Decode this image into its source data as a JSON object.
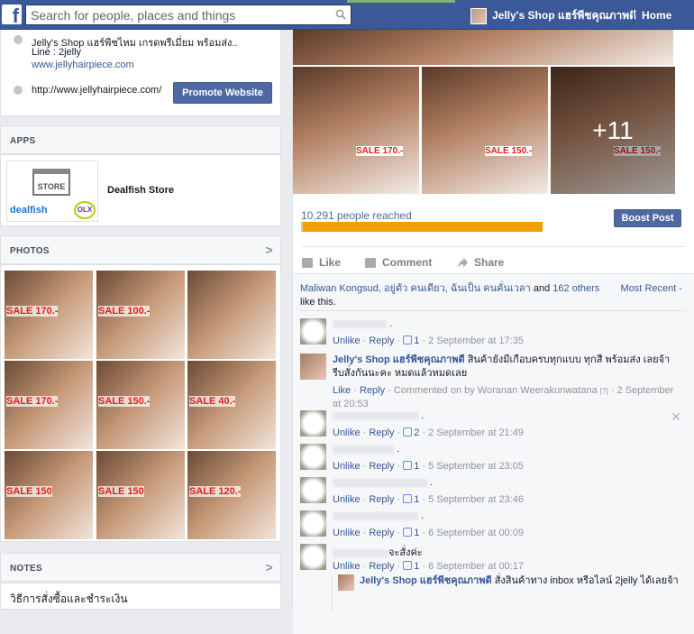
{
  "topbar": {
    "logo": "f",
    "search_placeholder": "Search for people, places and things",
    "profile_name": "Jelly's Shop แฮร์พีชคุณภาพดี",
    "home_label": "Home"
  },
  "info": {
    "about": "Jelly's Shop แฮร์พีชไหม เกรดพรีเมี่ยม พร้อมส่ง..",
    "line": "Line : 2jelly",
    "site_link": "www.jellyhairpiece.com",
    "website": "http://www.jellyhairpiece.com/",
    "promote_label": "Promote Website"
  },
  "apps": {
    "title": "APPS",
    "app_name": "Dealfish Store",
    "logo_store": "STORE",
    "logo_brand": "dealfish",
    "logo_olx": "OLX"
  },
  "photos": {
    "title": "PHOTOS",
    "labels": [
      "SALE 170.-",
      "SALE 100.-",
      "",
      "",
      "SALE 170.-",
      "SALE 150.-",
      "SALE 40.-",
      "",
      "SALE 150",
      "SALE 150",
      "SALE 120.-"
    ]
  },
  "notes": {
    "title": "NOTES",
    "first": "วิธีการสั่งซื้อและชำระเงิน"
  },
  "post": {
    "photo_labels": [
      "SALE 170.-",
      "SALE 150.-",
      "SALE 150.-"
    ],
    "more_count": "+11",
    "reach": "10,291 people reached",
    "reach_fraction": 0.62,
    "boost_label": "Boost Post",
    "actions": {
      "like": "Like",
      "comment": "Comment",
      "share": "Share"
    },
    "likes": {
      "names": "Maliwan Kongsud, อยู่ตัว คนเดียว, ฉันเป็น คนคั่นเวลา",
      "and": " and ",
      "others": "162 others",
      "suffix": " like this."
    },
    "sort_label": "Most Recent -",
    "comments": [
      {
        "text": ".",
        "unlike": "Unlike",
        "reply": "Reply",
        "likes": "1",
        "time": "2 September at 17:35"
      },
      {
        "author": "Jelly's Shop แฮร์พีชคุณภาพดี",
        "text": "สินค้ายังมีเกือบครบทุกแบบ ทุกสี พร้อมส่ง เลยจ้า รีบสั่งกันนะคะ หมดแล้วหมดเลย",
        "like": "Like",
        "reply": "Reply",
        "meta": "Commented on by Woranan Weerakunwatana",
        "help": "[?]",
        "time": "2 September at 20:53"
      },
      {
        "text": ".",
        "unlike": "Unlike",
        "reply": "Reply",
        "likes": "2",
        "time": "2 September at 21:49"
      },
      {
        "text": ".",
        "unlike": "Unlike",
        "reply": "Reply",
        "likes": "1",
        "time": "5 September at 23:05"
      },
      {
        "text": ".",
        "unlike": "Unlike",
        "reply": "Reply",
        "likes": "1",
        "time": "5 September at 23:46"
      },
      {
        "text": ".",
        "unlike": "Unlike",
        "reply": "Reply",
        "likes": "1",
        "time": "6 September at 00:09"
      },
      {
        "text": "จะสั่งค่ะ",
        "unlike": "Unlike",
        "reply": "Reply",
        "likes": "1",
        "time": "6 September at 00:17"
      }
    ],
    "reply": {
      "author": "Jelly's Shop แฮร์พีชคุณภาพดี",
      "text": "สั่งสินค้าทาง inbox หรือไลน์ 2jelly ได้เลยจ้า"
    }
  }
}
